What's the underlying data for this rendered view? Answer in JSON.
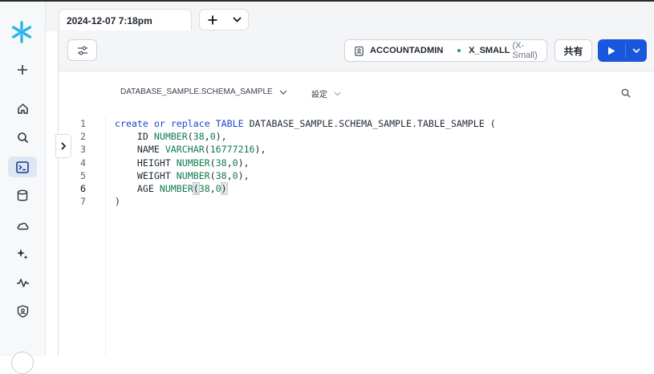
{
  "rail": {
    "items": [
      "snowflake-logo",
      "add",
      "home",
      "search",
      "worksheets",
      "data",
      "cloud",
      "ai",
      "activity",
      "admin"
    ]
  },
  "tabs": {
    "active_label": "2024-12-07 7:18pm"
  },
  "toolbar": {
    "role": "ACCOUNTADMIN",
    "warehouse": "X_SMALL",
    "warehouse_size": "(X-Small)",
    "share_label": "共有"
  },
  "context": {
    "database_schema": "DATABASE_SAMPLE.SCHEMA_SAMPLE",
    "settings_label": "設定"
  },
  "editor": {
    "current_line": 6,
    "lines": [
      {
        "n": "1",
        "tokens": [
          [
            "kw",
            "create"
          ],
          [
            "t",
            " "
          ],
          [
            "kw",
            "or"
          ],
          [
            "t",
            " "
          ],
          [
            "kw",
            "replace"
          ],
          [
            "t",
            " "
          ],
          [
            "kw",
            "TABLE"
          ],
          [
            "t",
            " DATABASE_SAMPLE.SCHEMA_SAMPLE.TABLE_SAMPLE ("
          ]
        ]
      },
      {
        "n": "2",
        "tokens": [
          [
            "t",
            "    ID "
          ],
          [
            "fn",
            "NUMBER"
          ],
          [
            "t",
            "("
          ],
          [
            "num",
            "38"
          ],
          [
            "t",
            ","
          ],
          [
            "num",
            "0"
          ],
          [
            "t",
            "),"
          ]
        ]
      },
      {
        "n": "3",
        "tokens": [
          [
            "t",
            "    NAME "
          ],
          [
            "fn",
            "VARCHAR"
          ],
          [
            "t",
            "("
          ],
          [
            "num",
            "16777216"
          ],
          [
            "t",
            "),"
          ]
        ]
      },
      {
        "n": "4",
        "tokens": [
          [
            "t",
            "    HEIGHT "
          ],
          [
            "fn",
            "NUMBER"
          ],
          [
            "t",
            "("
          ],
          [
            "num",
            "38"
          ],
          [
            "t",
            ","
          ],
          [
            "num",
            "0"
          ],
          [
            "t",
            "),"
          ]
        ]
      },
      {
        "n": "5",
        "tokens": [
          [
            "t",
            "    WEIGHT "
          ],
          [
            "fn",
            "NUMBER"
          ],
          [
            "t",
            "("
          ],
          [
            "num",
            "38"
          ],
          [
            "t",
            ","
          ],
          [
            "num",
            "0"
          ],
          [
            "t",
            "),"
          ]
        ]
      },
      {
        "n": "6",
        "tokens": [
          [
            "t",
            "    AGE "
          ],
          [
            "fn",
            "NUMBER"
          ],
          [
            "br",
            "("
          ],
          [
            "num",
            "38"
          ],
          [
            "t",
            ","
          ],
          [
            "num",
            "0"
          ],
          [
            "br",
            ")"
          ]
        ]
      },
      {
        "n": "7",
        "tokens": [
          [
            "t",
            ")"
          ]
        ]
      }
    ]
  },
  "colors": {
    "accent": "#1a56db",
    "keyword": "#1a47c7",
    "function": "#107a4f",
    "logo": "#29b5e8",
    "status_dot": "#1f9d55"
  }
}
